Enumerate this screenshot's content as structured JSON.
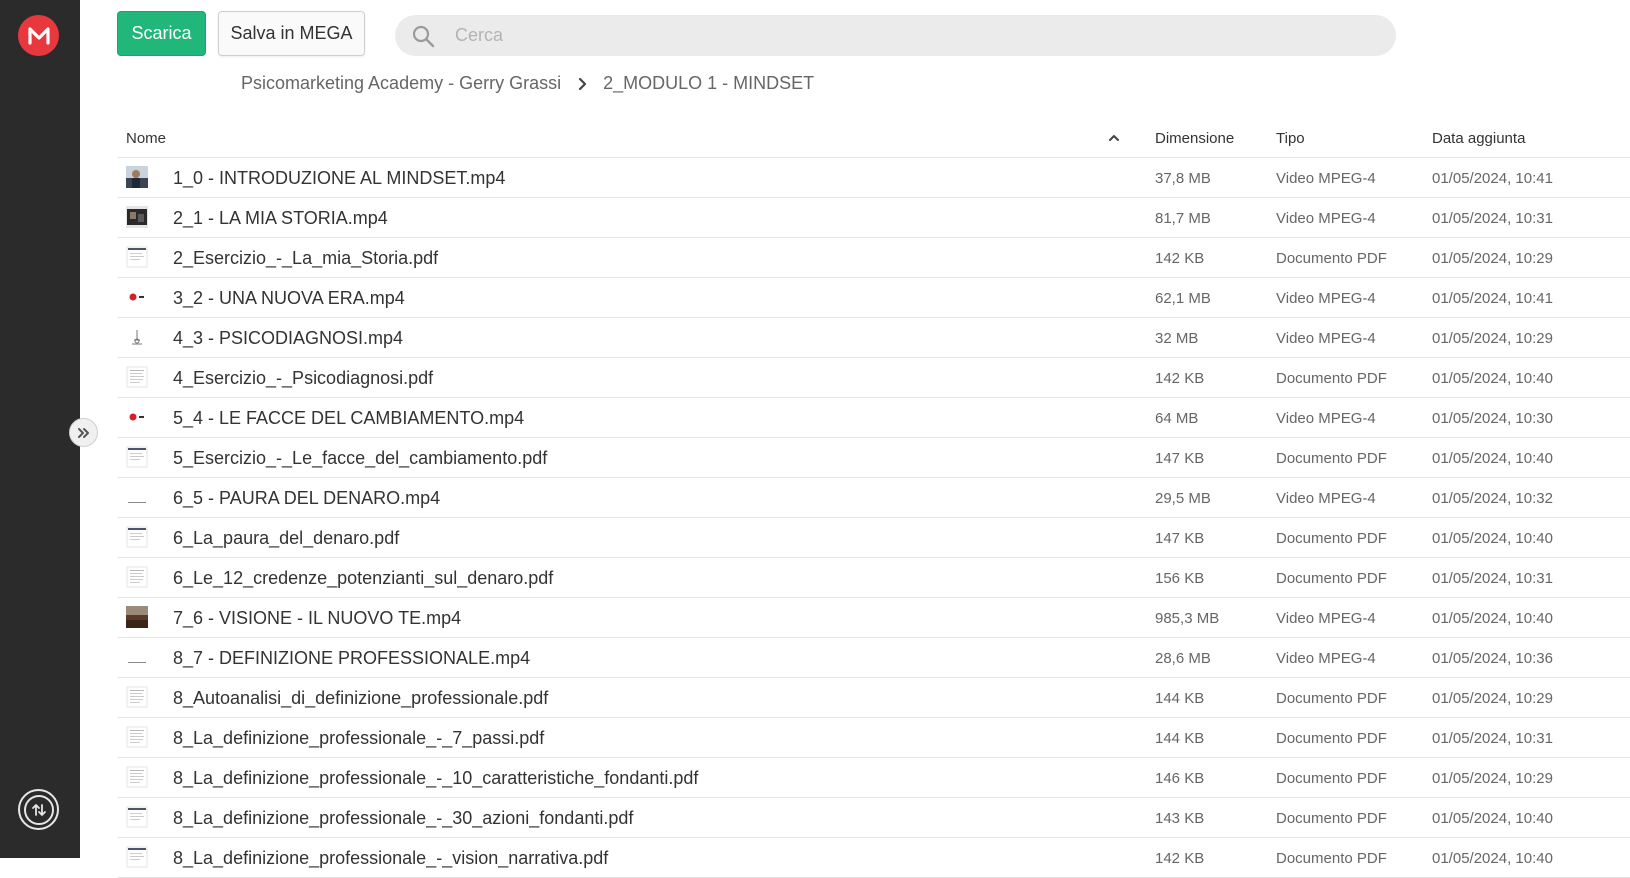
{
  "toolbar": {
    "download_label": "Scarica",
    "save_label": "Salva in MEGA"
  },
  "search": {
    "placeholder": "Cerca",
    "value": ""
  },
  "breadcrumb": {
    "root": "Psicomarketing Academy - Gerry Grassi",
    "current": "2_MODULO 1 - MINDSET"
  },
  "table": {
    "columns": {
      "name": "Nome",
      "size": "Dimensione",
      "type": "Tipo",
      "date": "Data aggiunta"
    },
    "sort": "ascending",
    "rows": [
      {
        "name": "1_0 - INTRODUZIONE AL MINDSET.mp4",
        "size": "37,8 MB",
        "type": "Video MPEG-4",
        "date": "01/05/2024, 10:41",
        "thumb": "video-person"
      },
      {
        "name": "2_1 - LA MIA STORIA.mp4",
        "size": "81,7 MB",
        "type": "Video MPEG-4",
        "date": "01/05/2024, 10:31",
        "thumb": "video-dark"
      },
      {
        "name": "2_Esercizio_-_La_mia_Storia.pdf",
        "size": "142 KB",
        "type": "Documento PDF",
        "date": "01/05/2024, 10:29",
        "thumb": "pdf-header"
      },
      {
        "name": "3_2 - UNA NUOVA ERA.mp4",
        "size": "62,1 MB",
        "type": "Video MPEG-4",
        "date": "01/05/2024, 10:41",
        "thumb": "video-reddot"
      },
      {
        "name": "4_3 - PSICODIAGNOSI.mp4",
        "size": "32 MB",
        "type": "Video MPEG-4",
        "date": "01/05/2024, 10:29",
        "thumb": "video-diagram"
      },
      {
        "name": "4_Esercizio_-_Psicodiagnosi.pdf",
        "size": "142 KB",
        "type": "Documento PDF",
        "date": "01/05/2024, 10:40",
        "thumb": "pdf-lines"
      },
      {
        "name": "5_4 - LE FACCE DEL CAMBIAMENTO.mp4",
        "size": "64 MB",
        "type": "Video MPEG-4",
        "date": "01/05/2024, 10:30",
        "thumb": "video-reddot"
      },
      {
        "name": "5_Esercizio_-_Le_facce_del_cambiamento.pdf",
        "size": "147 KB",
        "type": "Documento PDF",
        "date": "01/05/2024, 10:40",
        "thumb": "pdf-header"
      },
      {
        "name": "6_5 - PAURA DEL DENARO.mp4",
        "size": "29,5 MB",
        "type": "Video MPEG-4",
        "date": "01/05/2024, 10:32",
        "thumb": "video-blank"
      },
      {
        "name": "6_La_paura_del_denaro.pdf",
        "size": "147 KB",
        "type": "Documento PDF",
        "date": "01/05/2024, 10:40",
        "thumb": "pdf-header"
      },
      {
        "name": "6_Le_12_credenze_potenzianti_sul_denaro.pdf",
        "size": "156 KB",
        "type": "Documento PDF",
        "date": "01/05/2024, 10:31",
        "thumb": "pdf-lines"
      },
      {
        "name": "7_6 - VISIONE - IL NUOVO TE.mp4",
        "size": "985,3 MB",
        "type": "Video MPEG-4",
        "date": "01/05/2024, 10:40",
        "thumb": "video-landscape"
      },
      {
        "name": "8_7 - DEFINIZIONE PROFESSIONALE.mp4",
        "size": "28,6 MB",
        "type": "Video MPEG-4",
        "date": "01/05/2024, 10:36",
        "thumb": "video-blank"
      },
      {
        "name": "8_Autoanalisi_di_definizione_professionale.pdf",
        "size": "144 KB",
        "type": "Documento PDF",
        "date": "01/05/2024, 10:29",
        "thumb": "pdf-lines"
      },
      {
        "name": "8_La_definizione_professionale_-_7_passi.pdf",
        "size": "144 KB",
        "type": "Documento PDF",
        "date": "01/05/2024, 10:31",
        "thumb": "pdf-lines"
      },
      {
        "name": "8_La_definizione_professionale_-_10_caratteristiche_fondanti.pdf",
        "size": "146 KB",
        "type": "Documento PDF",
        "date": "01/05/2024, 10:29",
        "thumb": "pdf-lines"
      },
      {
        "name": "8_La_definizione_professionale_-_30_azioni_fondanti.pdf",
        "size": "143 KB",
        "type": "Documento PDF",
        "date": "01/05/2024, 10:40",
        "thumb": "pdf-header"
      },
      {
        "name": "8_La_definizione_professionale_-_vision_narrativa.pdf",
        "size": "142 KB",
        "type": "Documento PDF",
        "date": "01/05/2024, 10:40",
        "thumb": "pdf-header"
      }
    ]
  },
  "colors": {
    "accent": "#21b77b",
    "brand": "#e8383d",
    "sidebar": "#2b2b2b"
  }
}
